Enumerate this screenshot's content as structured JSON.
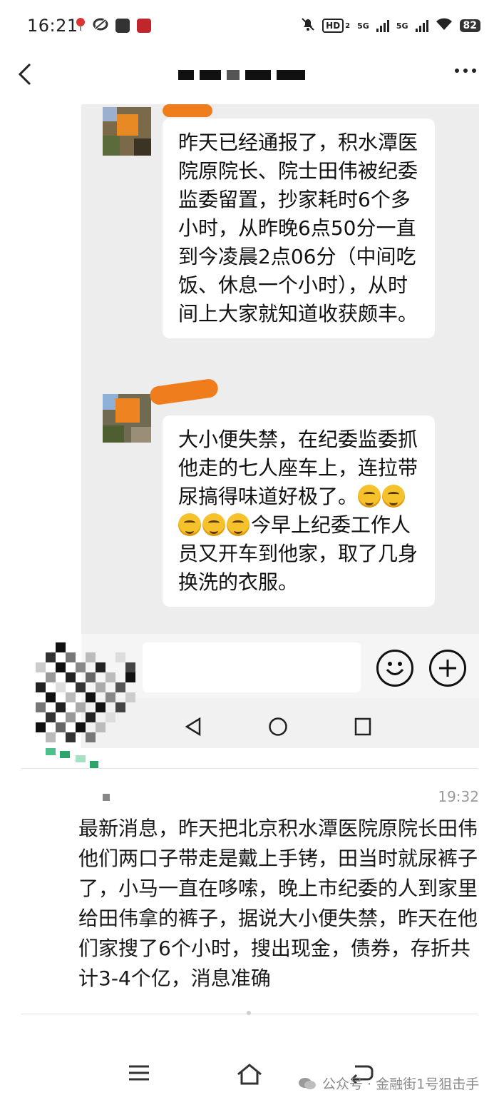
{
  "status_bar": {
    "time": "16:21",
    "network_badge": "HD",
    "network_sub": "2",
    "sim1": "5G",
    "sim2": "5G",
    "battery": "82"
  },
  "header": {
    "back_icon": "chevron-left-icon",
    "more_icon": "more-dots-icon"
  },
  "inner_chat": {
    "messages": [
      {
        "text": "昨天已经通报了，积水潭医院原院长、院士田伟被纪委监委留置，抄家耗时6个多小时，从昨晚6点50分一直到今凌晨2点06分（中间吃饭、休息一个小时），从时间上大家就知道收获颇丰。"
      },
      {
        "text_before": "大小便失禁，在纪委监委抓他走的七人座车上，连拉带尿搞得味道好极了。",
        "emoji_count": 5,
        "text_after": "今早上纪委工作人员又开车到他家，取了几身换洗的衣服。"
      }
    ],
    "emoji_icon": "smiley-icon",
    "plus_icon": "plus-circle-icon"
  },
  "outer_message": {
    "time": "19:32",
    "text": "最新消息，昨天把北京积水潭医院原院长田伟他们两口子带走是戴上手铐，田当时就尿裤子了，小马一直在哆嗦，晚上市纪委的人到家里给田伟拿的裤子，据说大小便失禁，昨天在他们家搜了6个小时，搜出现金，债券，存折共计3-4个亿，消息准确"
  },
  "bottom_nav": {
    "menu_icon": "menu-icon",
    "home_icon": "home-icon",
    "back_icon": "return-icon"
  },
  "watermark": {
    "text": "公众号 · 金融街1号狙击手"
  },
  "colors": {
    "inner_background": "#ededed",
    "bubble": "#ffffff",
    "smudge": "#f07d1c"
  }
}
